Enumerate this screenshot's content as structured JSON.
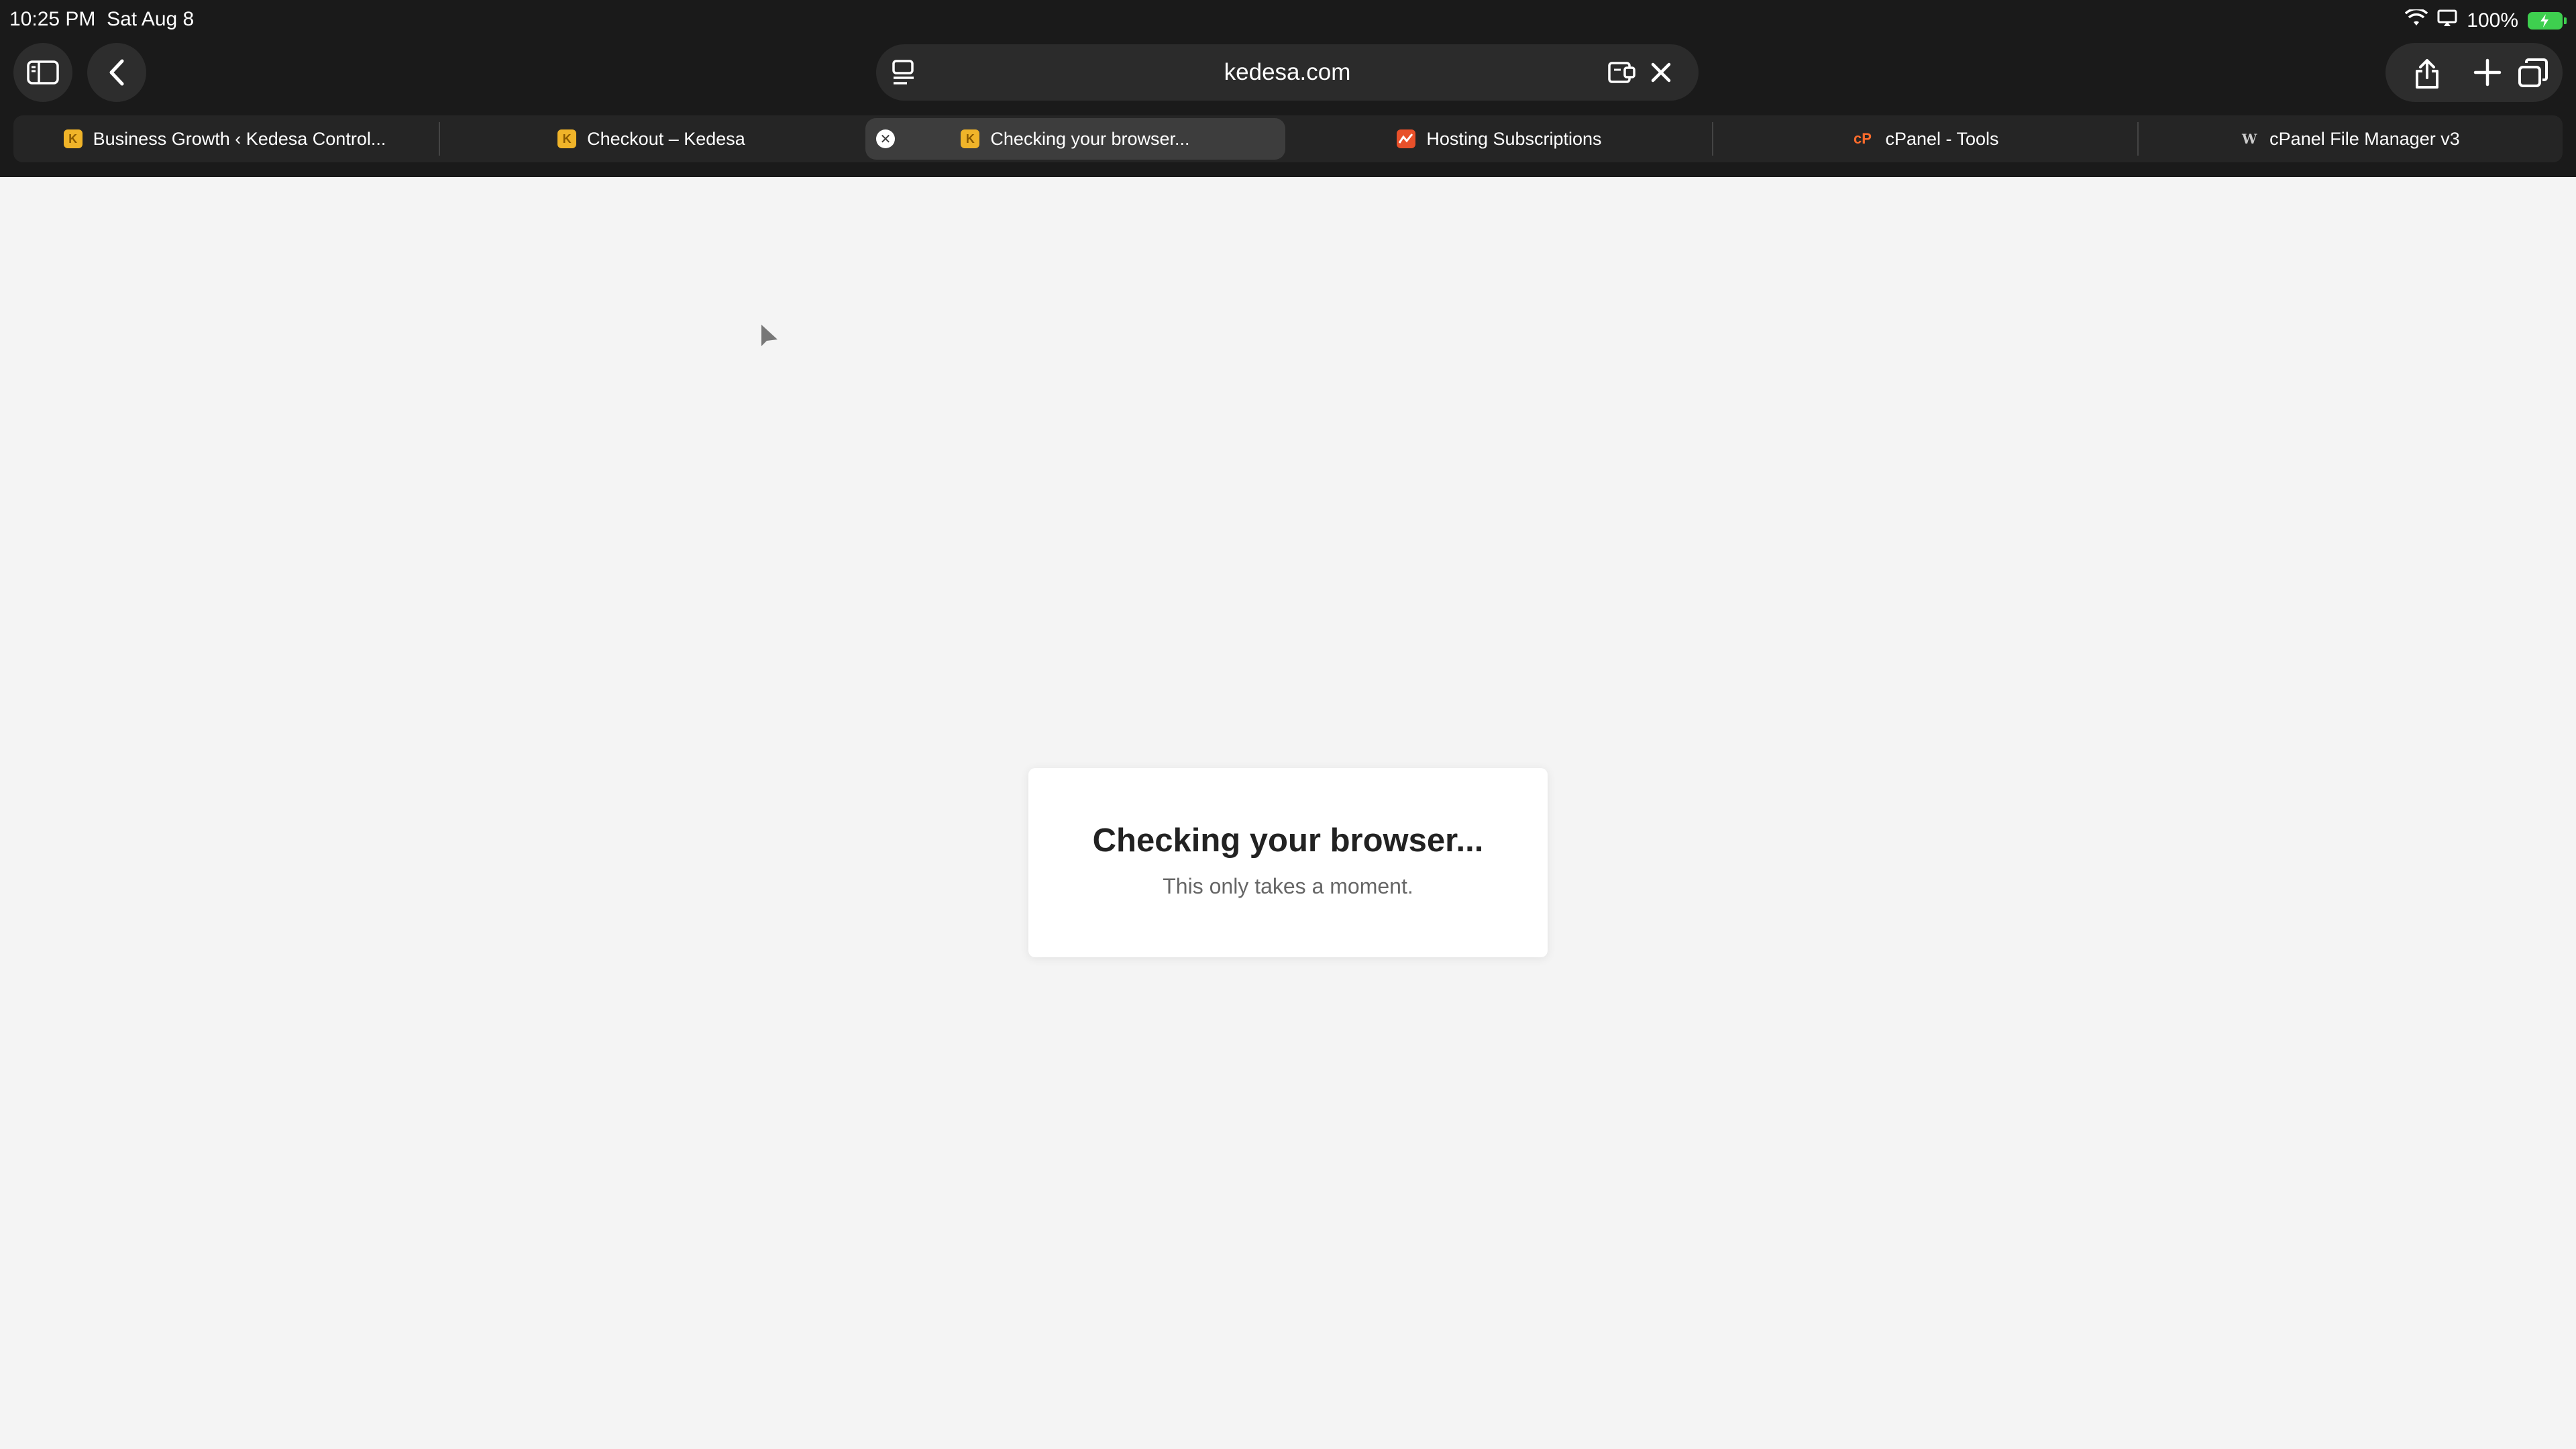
{
  "status_bar": {
    "time": "10:25 PM",
    "date": "Sat Aug 8",
    "battery": "100%"
  },
  "toolbar": {
    "address": "kedesa.com",
    "icons": [
      "sidebar-icon",
      "back-chevron-icon",
      "reader-icon",
      "extension-icon",
      "close-icon",
      "share-icon",
      "plus-icon",
      "tabs-overview-icon"
    ]
  },
  "tabs": [
    {
      "label": "Business Growth ‹ Kedesa Control...",
      "favicon": "K"
    },
    {
      "label": "Checkout – Kedesa",
      "favicon": "K"
    },
    {
      "label": "Checking your browser...",
      "favicon": "K",
      "active": true
    },
    {
      "label": "Hosting Subscriptions",
      "favicon": ""
    },
    {
      "label": "cPanel - Tools",
      "favicon": "cP"
    },
    {
      "label": "cPanel File Manager v3",
      "favicon": "W"
    }
  ],
  "page": {
    "title": "Checking your browser...",
    "subtitle": "This only takes a moment."
  },
  "colors": {
    "accent": "#3a82f7",
    "kedesa_favicon": "#f0b429",
    "hosting_favicon": "#e8502a",
    "cpanel_favicon": "#ff6c2c",
    "battery": "#3ecf4f"
  }
}
